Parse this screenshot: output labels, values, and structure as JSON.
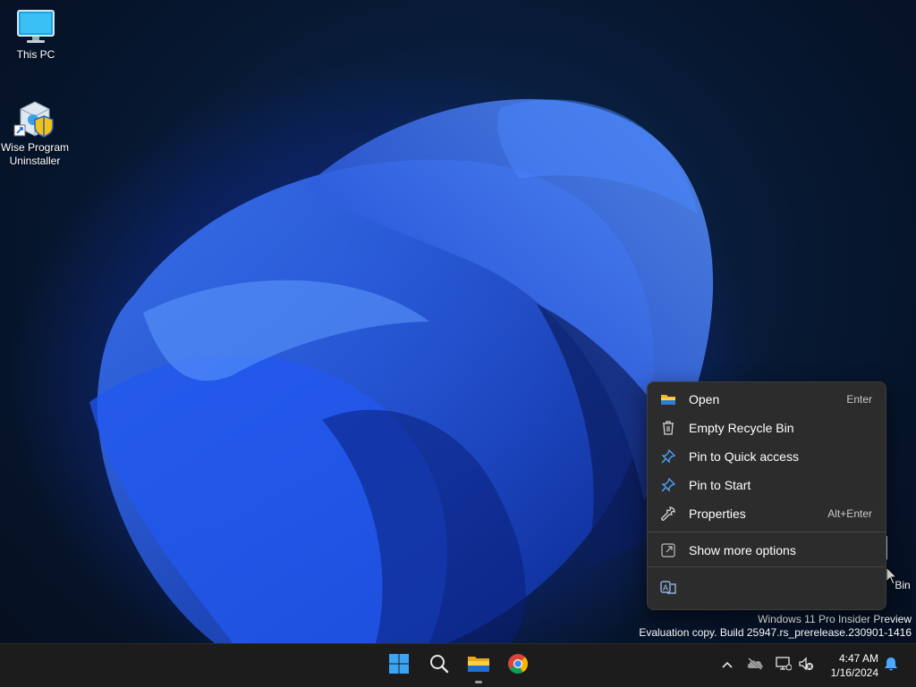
{
  "desktop": {
    "icons": [
      {
        "label": "This PC",
        "icon": "computer-monitor-icon"
      },
      {
        "label": "Wise Program\nUninstaller",
        "icon": "uninstaller-box-icon"
      },
      {
        "label": "Bin",
        "icon": "recycle-bin-icon"
      }
    ]
  },
  "context_menu": {
    "items": [
      {
        "label": "Open",
        "shortcut": "Enter",
        "icon": "folder-icon"
      },
      {
        "label": "Empty Recycle Bin",
        "shortcut": "",
        "icon": "trash-icon"
      },
      {
        "label": "Pin to Quick access",
        "shortcut": "",
        "icon": "pin-icon"
      },
      {
        "label": "Pin to Start",
        "shortcut": "",
        "icon": "pin-icon"
      },
      {
        "label": "Properties",
        "shortcut": "Alt+Enter",
        "icon": "wrench-icon"
      },
      {
        "label": "Show more options",
        "shortcut": "",
        "icon": "open-external-icon"
      }
    ],
    "bottom_icon": "ai-translate-icon"
  },
  "watermark": {
    "line1": "Windows 11 Pro Insider Preview",
    "line2": "Evaluation copy. Build 25947.rs_prerelease.230901-1416"
  },
  "taskbar": {
    "apps": [
      "start-icon",
      "search-icon",
      "file-explorer-icon",
      "chrome-icon"
    ],
    "tray": [
      "chevron-up-icon",
      "cloud-offline-icon",
      "network-icon",
      "volume-muted-icon"
    ],
    "time": "4:47 AM",
    "date": "1/16/2024",
    "notification_icon": "bell-icon"
  },
  "colors": {
    "taskbar_bg": "#1c1c1c",
    "menu_bg": "#2c2c2c",
    "accent": "#0078d4"
  }
}
